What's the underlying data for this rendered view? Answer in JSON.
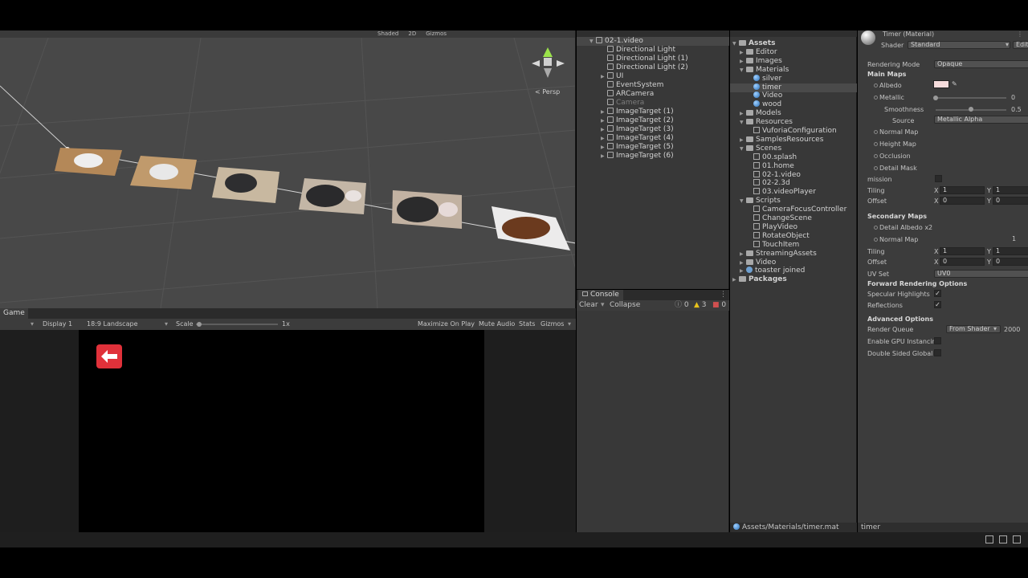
{
  "colors": {
    "accent": "#3a72b0",
    "back_button": "#e0313a",
    "selection": "#474747"
  },
  "scene": {
    "toolbar": [
      "Shaded",
      "2D",
      "Gizmos"
    ],
    "perspective_label": "< Persp",
    "gizmo_axes": [
      "y",
      "x",
      "z"
    ]
  },
  "game": {
    "tab_label": "Game",
    "display": "Display 1",
    "aspect": "18:9 Landscape",
    "scale_label": "Scale",
    "scale_value": "1x",
    "maximize": "Maximize On Play",
    "mute": "Mute Audio",
    "stats": "Stats",
    "gizmos": "Gizmos",
    "back_icon": "arrow-left-icon"
  },
  "hierarchy": {
    "items": [
      {
        "label": "02-1.video",
        "kind": "scene",
        "depth": 0,
        "selected": true
      },
      {
        "label": "Directional Light",
        "kind": "object",
        "depth": 1
      },
      {
        "label": "Directional Light (1)",
        "kind": "object",
        "depth": 1
      },
      {
        "label": "Directional Light (2)",
        "kind": "object",
        "depth": 1
      },
      {
        "label": "UI",
        "kind": "object",
        "depth": 1,
        "expandable": true
      },
      {
        "label": "EventSystem",
        "kind": "object",
        "depth": 1
      },
      {
        "label": "ARCamera",
        "kind": "object",
        "depth": 1
      },
      {
        "label": "Camera",
        "kind": "object",
        "depth": 1,
        "dim": true
      },
      {
        "label": "ImageTarget (1)",
        "kind": "object",
        "depth": 1,
        "expandable": true
      },
      {
        "label": "ImageTarget (2)",
        "kind": "object",
        "depth": 1,
        "expandable": true
      },
      {
        "label": "ImageTarget (3)",
        "kind": "object",
        "depth": 1,
        "expandable": true
      },
      {
        "label": "ImageTarget (4)",
        "kind": "object",
        "depth": 1,
        "expandable": true
      },
      {
        "label": "ImageTarget (5)",
        "kind": "object",
        "depth": 1,
        "expandable": true
      },
      {
        "label": "ImageTarget (6)",
        "kind": "object",
        "depth": 1,
        "expandable": true
      }
    ]
  },
  "console": {
    "tab_label": "Console",
    "clear": "Clear",
    "collapse": "Collapse",
    "log_count": "0",
    "warn_count": "3",
    "error_count": "0"
  },
  "project": {
    "items": [
      {
        "label": "Assets",
        "kind": "folder",
        "depth": 0,
        "bold": true,
        "open": true
      },
      {
        "label": "Editor",
        "kind": "folder",
        "depth": 1
      },
      {
        "label": "Images",
        "kind": "folder",
        "depth": 1
      },
      {
        "label": "Materials",
        "kind": "folder",
        "depth": 1,
        "open": true
      },
      {
        "label": "silver",
        "kind": "material",
        "depth": 2
      },
      {
        "label": "timer",
        "kind": "material",
        "depth": 2,
        "selected": true
      },
      {
        "label": "Video",
        "kind": "material",
        "depth": 2
      },
      {
        "label": "wood",
        "kind": "material",
        "depth": 2
      },
      {
        "label": "Models",
        "kind": "folder",
        "depth": 1
      },
      {
        "label": "Resources",
        "kind": "folder",
        "depth": 1,
        "open": true
      },
      {
        "label": "VuforiaConfiguration",
        "kind": "file",
        "depth": 2
      },
      {
        "label": "SamplesResources",
        "kind": "folder",
        "depth": 1
      },
      {
        "label": "Scenes",
        "kind": "folder",
        "depth": 1,
        "open": true
      },
      {
        "label": "00.splash",
        "kind": "scene",
        "depth": 2
      },
      {
        "label": "01.home",
        "kind": "scene",
        "depth": 2
      },
      {
        "label": "02-1.video",
        "kind": "scene",
        "depth": 2
      },
      {
        "label": "02-2.3d",
        "kind": "scene",
        "depth": 2
      },
      {
        "label": "03.videoPlayer",
        "kind": "scene",
        "depth": 2
      },
      {
        "label": "Scripts",
        "kind": "folder",
        "depth": 1,
        "open": true
      },
      {
        "label": "CameraFocusController",
        "kind": "file",
        "depth": 2
      },
      {
        "label": "ChangeScene",
        "kind": "file",
        "depth": 2
      },
      {
        "label": "PlayVideo",
        "kind": "file",
        "depth": 2
      },
      {
        "label": "RotateObject",
        "kind": "file",
        "depth": 2
      },
      {
        "label": "TouchItem",
        "kind": "file",
        "depth": 2
      },
      {
        "label": "StreamingAssets",
        "kind": "folder",
        "depth": 1
      },
      {
        "label": "Video",
        "kind": "folder",
        "depth": 1
      },
      {
        "label": "toaster joined",
        "kind": "model",
        "depth": 1
      },
      {
        "label": "Packages",
        "kind": "folder",
        "depth": 0,
        "bold": true
      }
    ],
    "footer_path": "Assets/Materials/timer.mat"
  },
  "inspector": {
    "title": "Timer (Material)",
    "shader_label": "Shader",
    "shader_value": "Standard",
    "edit_label": "Edit",
    "rendering_mode_label": "Rendering Mode",
    "rendering_mode_value": "Opaque",
    "main_maps": "Main Maps",
    "albedo": "Albedo",
    "albedo_color": "#f6dcdc",
    "metallic": "Metallic",
    "metallic_value": "0",
    "smoothness": "Smoothness",
    "smoothness_value": "0.5",
    "source_label": "Source",
    "source_value": "Metallic Alpha",
    "normal_map": "Normal Map",
    "height_map": "Height Map",
    "occlusion": "Occlusion",
    "detail_mask": "Detail Mask",
    "emission": "mission",
    "tiling": "Tiling",
    "offset": "Offset",
    "x": "X",
    "y": "Y",
    "tiling_x": "1",
    "tiling_y": "1",
    "offset_x": "0",
    "offset_y": "0",
    "secondary_maps": "Secondary Maps",
    "detail_albedo": "Detail Albedo x2",
    "normal_map_2": "Normal Map",
    "normal_scale_2": "1",
    "tiling2_x": "1",
    "tiling2_y": "1",
    "offset2_x": "0",
    "offset2_y": "0",
    "uv_set_label": "UV Set",
    "uv_set_value": "UV0",
    "forward_options": "Forward Rendering Options",
    "specular_highlights": "Specular Highlights",
    "reflections": "Reflections",
    "advanced_options": "Advanced Options",
    "render_queue": "Render Queue",
    "render_queue_mode": "From Shader",
    "render_queue_value": "2000",
    "gpu_instancing": "Enable GPU Instancin",
    "double_sided": "Double Sided Global I",
    "footer": "timer"
  }
}
